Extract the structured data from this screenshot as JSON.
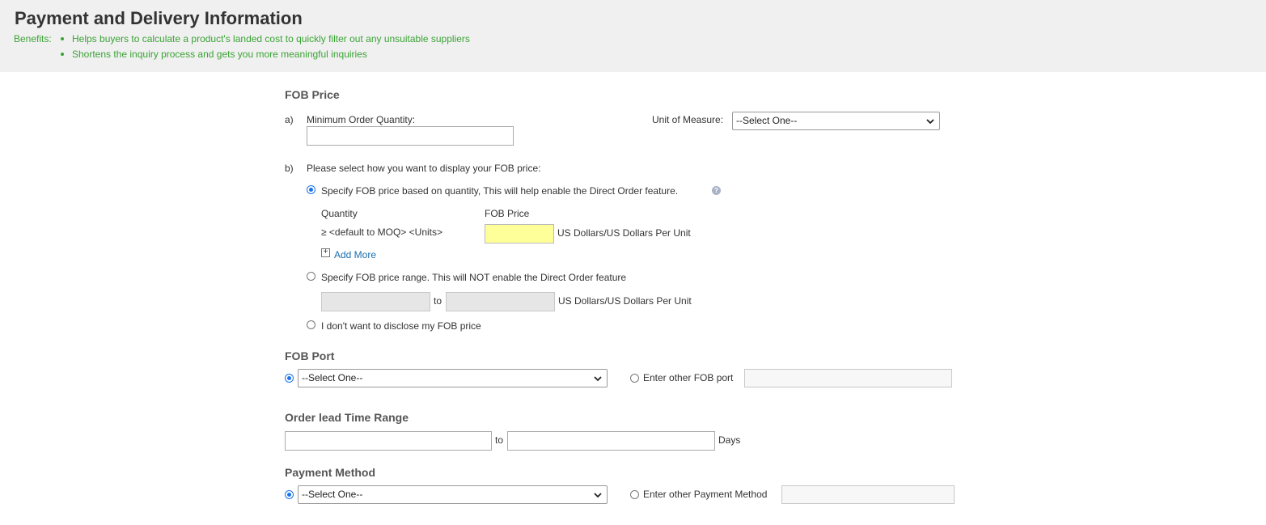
{
  "header": {
    "title": "Payment and Delivery Information",
    "benefits_label": "Benefits:",
    "benefits": [
      "Helps buyers to calculate a product's landed cost to quickly filter out any unsuitable suppliers",
      "Shortens the inquiry process and gets you more meaningful inquiries"
    ]
  },
  "fob_price": {
    "title": "FOB Price",
    "a_marker": "a)",
    "moq_label": "Minimum Order Quantity:",
    "moq_value": "",
    "uom_label": "Unit of Measure:",
    "uom_selected": "--Select One--",
    "b_marker": "b)",
    "b_prompt": "Please select how you want to display your FOB price:",
    "option_quantity_label": "Specify FOB price based on quantity, This will help enable the Direct Order feature.",
    "option_quantity_selected": true,
    "quantity_header": "Quantity",
    "fob_price_header": "FOB Price",
    "quantity_default": "≥ <default to MOQ> <Units>",
    "price_value": "",
    "unit_text": "US Dollars/US Dollars Per Unit",
    "add_more": "Add More",
    "option_range_label": "Specify FOB price range. This will NOT enable the Direct Order feature",
    "option_range_selected": false,
    "range_to": "to",
    "range_unit_text": "US Dollars/US Dollars Per Unit",
    "option_nodisclose_label": "I don't want to disclose my FOB price",
    "option_nodisclose_selected": false,
    "help_symbol": "?",
    "plus_symbol": "+"
  },
  "fob_port": {
    "title": "FOB Port",
    "select_selected": "--Select One--",
    "other_label": "Enter other FOB port",
    "other_value": ""
  },
  "lead_time": {
    "title": "Order lead Time Range",
    "from_value": "",
    "to_label": "to",
    "to_value": "",
    "unit": "Days"
  },
  "payment": {
    "title": "Payment Method",
    "select_selected": "--Select One--",
    "other_label": "Enter other Payment Method",
    "other_value": ""
  },
  "colors": {
    "benefit_green": "#3aa335",
    "link_blue": "#1a6fb0",
    "highlight_yellow": "#ffff99"
  }
}
